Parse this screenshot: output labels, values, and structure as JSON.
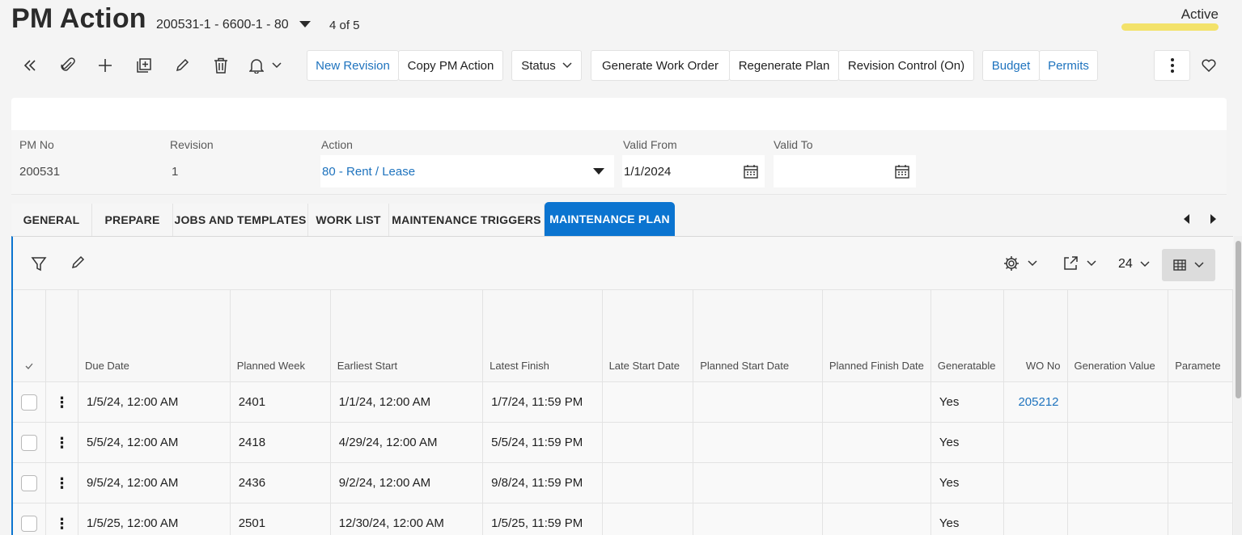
{
  "header": {
    "title": "PM Action",
    "record": "200531-1 - 6600-1 - 80",
    "count": "4 of 5",
    "state": "Active",
    "state_color": "#f3e26a"
  },
  "toolbar": {
    "icons": [
      "collapse-icon",
      "attachment-icon",
      "add-icon",
      "duplicate-icon",
      "edit-icon",
      "delete-icon",
      "bell-icon"
    ],
    "new_revision": "New Revision",
    "copy_pm_action": "Copy PM Action",
    "status": "Status",
    "generate_work_order": "Generate Work Order",
    "regenerate_plan": "Regenerate Plan",
    "revision_control": "Revision Control (On)",
    "budget": "Budget",
    "permits": "Permits"
  },
  "form": {
    "pm_no_label": "PM No",
    "pm_no": "200531",
    "revision_label": "Revision",
    "revision": "1",
    "action_label": "Action",
    "action": "80 - Rent / Lease",
    "valid_from_label": "Valid From",
    "valid_from": "1/1/2024",
    "valid_to_label": "Valid To",
    "valid_to": ""
  },
  "tabs": [
    "GENERAL",
    "PREPARE",
    "JOBS AND TEMPLATES",
    "WORK LIST",
    "MAINTENANCE TRIGGERS",
    "MAINTENANCE PLAN"
  ],
  "active_tab": "MAINTENANCE PLAN",
  "grid": {
    "page_size": "24",
    "columns": [
      "Due Date",
      "Planned Week",
      "Earliest Start",
      "Latest Finish",
      "Late Start Date",
      "Planned Start Date",
      "Planned Finish Date",
      "Generatable",
      "WO No",
      "Generation Value",
      "Paramete"
    ],
    "rows": [
      [
        "1/5/24, 12:00 AM",
        "2401",
        "1/1/24, 12:00 AM",
        "1/7/24, 11:59 PM",
        "",
        "",
        "",
        "Yes",
        "205212",
        "",
        ""
      ],
      [
        "5/5/24, 12:00 AM",
        "2418",
        "4/29/24, 12:00 AM",
        "5/5/24, 11:59 PM",
        "",
        "",
        "",
        "Yes",
        "",
        "",
        ""
      ],
      [
        "9/5/24, 12:00 AM",
        "2436",
        "9/2/24, 12:00 AM",
        "9/8/24, 11:59 PM",
        "",
        "",
        "",
        "Yes",
        "",
        "",
        ""
      ],
      [
        "1/5/25, 12:00 AM",
        "2501",
        "12/30/24, 12:00 AM",
        "1/5/25, 11:59 PM",
        "",
        "",
        "",
        "Yes",
        "",
        "",
        ""
      ]
    ]
  },
  "colors": {
    "accent": "#0b74d0",
    "link": "#1e73be"
  }
}
